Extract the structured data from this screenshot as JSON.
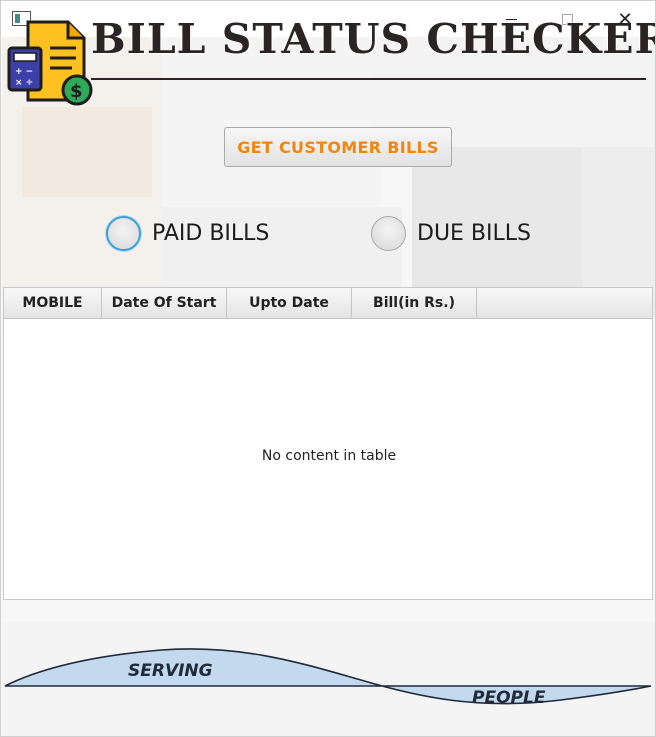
{
  "window": {
    "title": "",
    "controls": {
      "minimize_icon": "minimize-icon",
      "maximize_icon": "maximize-icon",
      "close_icon": "close-icon"
    }
  },
  "header": {
    "title": "BILL STATUS CHECKER",
    "logo_icon": "bill-document-icon"
  },
  "actions": {
    "get_bills_label": "GET CUSTOMER BILLS"
  },
  "filters": {
    "paid_label": "PAID BILLS",
    "due_label": "DUE BILLS",
    "selected": "none"
  },
  "table": {
    "columns": [
      "MOBILE",
      "Date Of Start",
      "Upto Date",
      "Bill(in Rs.)"
    ],
    "rows": [],
    "empty_message": "No content in table"
  },
  "footer": {
    "left_label": "SERVING",
    "right_label": "PEOPLE"
  },
  "colors": {
    "accent_orange": "#f0860e",
    "wave_blue": "#c3d9ee",
    "focus_blue": "#3aa0d8",
    "title_dark": "#2a2424"
  }
}
